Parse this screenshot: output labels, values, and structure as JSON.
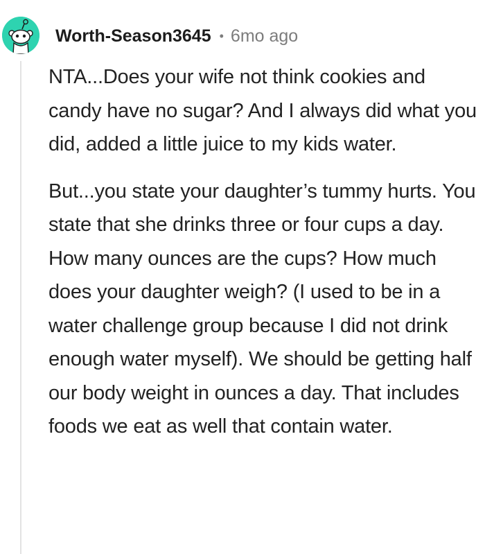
{
  "comment": {
    "username": "Worth-Season3645",
    "separator": "•",
    "timestamp": "6mo ago",
    "avatar_icon": "snoo-avatar-icon",
    "avatar_color": "#2ed3b0",
    "paragraphs": [
      "NTA...Does your wife not think cookies and candy have no sugar? And I always did what you did, added a little juice to my kids water.",
      "But...you state your daughter’s tummy hurts. You state that she drinks three or four cups a day. How many ounces are the cups? How much does your daughter weigh? (I used to be in a water challenge group because I did not drink enough water myself). We should be getting half our body weight in ounces a day. That includes foods we eat as well that contain water."
    ]
  }
}
